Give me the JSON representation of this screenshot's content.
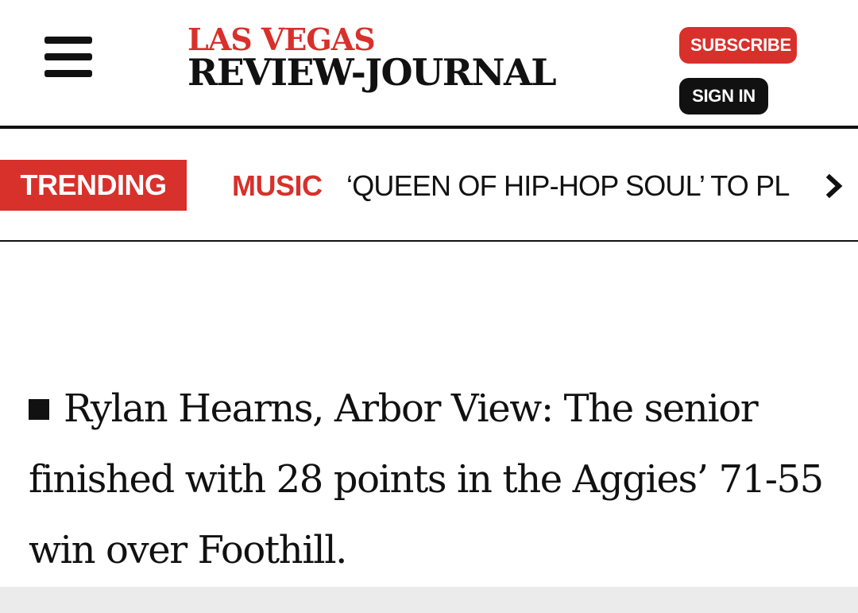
{
  "header": {
    "logo_top": "LAS VEGAS",
    "logo_bottom": "REVIEW-JOURNAL",
    "subscribe_label": "SUBSCRIBE",
    "signin_label": "SIGN IN"
  },
  "trending": {
    "badge": "TRENDING",
    "category": "MUSIC",
    "headline": "‘QUEEN OF HIP-HOP SOUL’ TO PL"
  },
  "article": {
    "paragraph": "Rylan Hearns, Arbor View: The senior finished with 28 points in the Aggies’ 71-55 win over Foothill."
  },
  "colors": {
    "brand_red": "#d8302b",
    "text": "#111111",
    "footer_band": "#ebebeb"
  },
  "icons": {
    "menu": "hamburger-menu-icon",
    "next": "chevron-right-icon",
    "bullet": "square-bullet-icon"
  }
}
